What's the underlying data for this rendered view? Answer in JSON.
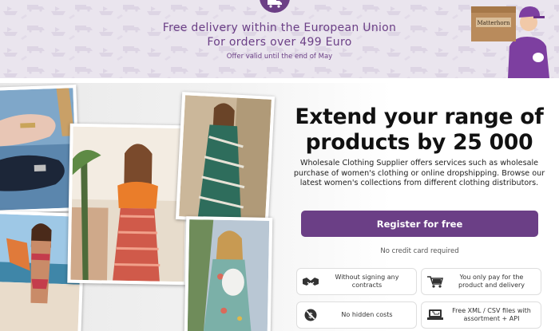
{
  "banner": {
    "line1": "Free delivery within the European Union",
    "line2": "For orders over 499 Euro",
    "line3": "Offer valid until the end of May",
    "box_label": "Matterhorn",
    "truck_icon": "truck-icon",
    "accent": "#6b3f86"
  },
  "hero": {
    "headline": "Extend your range of products by 25 000",
    "description": "Wholesale Clothing Supplier offers services such as wholesale purchase of women's clothing or online dropshipping. Browse our latest women's collections from different clothing distributors.",
    "register_label": "Register for free",
    "no_card": "No credit card required",
    "features": [
      {
        "text": "Without signing any contracts",
        "icon": "handshake-icon"
      },
      {
        "text": "You only pay for the product and delivery",
        "icon": "cart-icon"
      },
      {
        "text": "No hidden costs",
        "icon": "no-hidden-costs-icon"
      },
      {
        "text": "Free XML / CSV files with assortment + API",
        "icon": "laptop-cart-icon"
      }
    ],
    "button_color": "#6b3f86"
  }
}
